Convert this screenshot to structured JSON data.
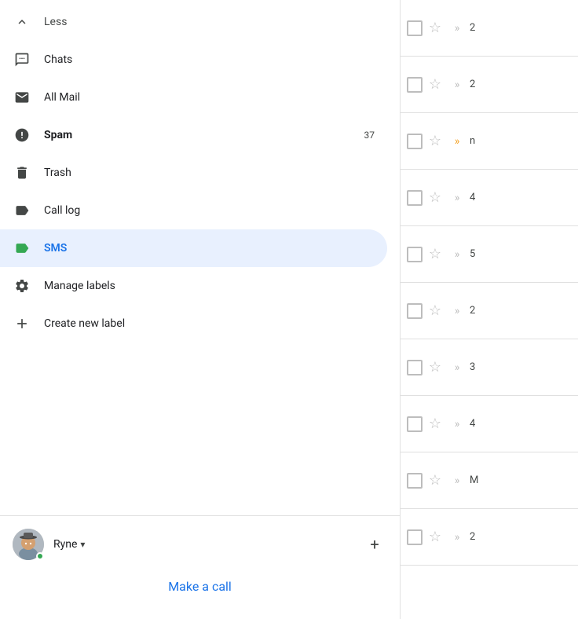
{
  "sidebar": {
    "less_label": "Less",
    "items": [
      {
        "id": "chats",
        "label": "Chats",
        "icon": "chat",
        "badge": null,
        "active": false
      },
      {
        "id": "all-mail",
        "label": "All Mail",
        "icon": "mail",
        "badge": null,
        "active": false
      },
      {
        "id": "spam",
        "label": "Spam",
        "icon": "spam",
        "badge": "37",
        "active": false,
        "bold": true
      },
      {
        "id": "trash",
        "label": "Trash",
        "icon": "trash",
        "badge": null,
        "active": false
      },
      {
        "id": "call-log",
        "label": "Call log",
        "icon": "tag",
        "badge": null,
        "active": false
      },
      {
        "id": "sms",
        "label": "SMS",
        "icon": "tag-green",
        "badge": null,
        "active": true
      },
      {
        "id": "manage-labels",
        "label": "Manage labels",
        "icon": "gear",
        "badge": null,
        "active": false
      },
      {
        "id": "create-label",
        "label": "Create new label",
        "icon": "plus",
        "badge": null,
        "active": false
      }
    ],
    "user": {
      "name": "Ryne",
      "online": true
    },
    "make_call": "Make a call"
  },
  "email_list": {
    "rows": [
      {
        "number": "2",
        "starred": false,
        "tag_color": "gray"
      },
      {
        "number": "2",
        "starred": false,
        "tag_color": "gray"
      },
      {
        "number": "n",
        "starred": false,
        "tag_color": "orange"
      },
      {
        "number": "4",
        "starred": false,
        "tag_color": "gray"
      },
      {
        "number": "5",
        "starred": false,
        "tag_color": "gray"
      },
      {
        "number": "2",
        "starred": false,
        "tag_color": "gray"
      },
      {
        "number": "3",
        "starred": false,
        "tag_color": "gray"
      },
      {
        "number": "4",
        "starred": false,
        "tag_color": "gray"
      },
      {
        "number": "M",
        "starred": false,
        "tag_color": "gray"
      },
      {
        "number": "2",
        "starred": false,
        "tag_color": "gray"
      }
    ]
  }
}
